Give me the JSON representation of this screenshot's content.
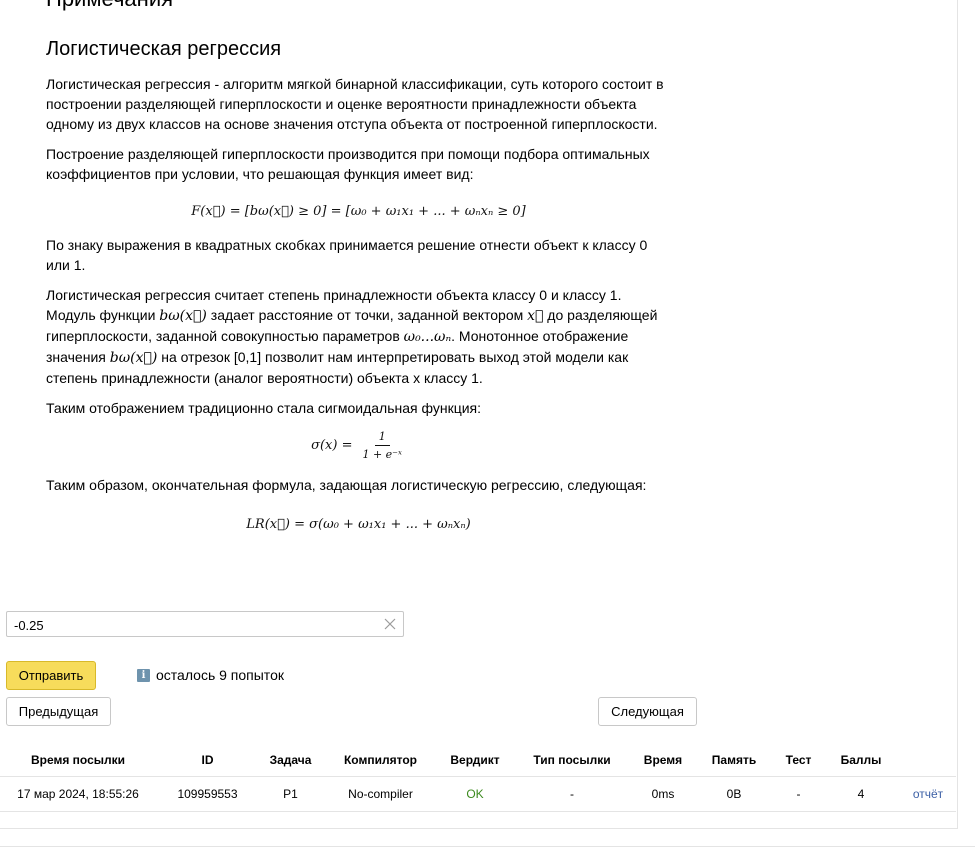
{
  "page": {
    "cut_title": "Примечания"
  },
  "statement": {
    "title": "Логистическая регрессия",
    "p1": "Логистическая регрессия - алгоритм мягкой бинарной классификации, суть которого состоит в построении разделяющей гиперплоскости и оценке вероятности принадлежности объекта одному из двух классов на основе значения отступа объекта от построенной гиперплоскости.",
    "p2": "Построение разделяющей гиперплоскости производится при помощи подбора оптимальных коэффициентов при условии, что решающая функция имеет вид:",
    "formula1": "F(x⃗) = [bω(x⃗) ≥ 0] = [ω₀ + ω₁x₁ + ... + ωₙxₙ ≥ 0]",
    "p3": "По знаку выражения в квадратных скобках принимается решение отнести объект к классу 0 или 1.",
    "p4_a": "Логистическая регрессия считает степень принадлежности объекта классу 0 и классу 1. Модуль функции ",
    "p4_m1": "bω(x⃗)",
    "p4_b": " задает расстояние от точки, заданной вектором ",
    "p4_m2": "x⃗",
    "p4_c": " до разделяющей гиперплоскости, заданной совокупностью параметров ",
    "p4_m3": "ω₀...ωₙ",
    "p4_d": ". Монотонное отображение значения ",
    "p4_m4": "bω(x⃗)",
    "p4_e": " на отрезок [0,1] позволит нам интерпретировать выход этой модели как степень принадлежности (аналог вероятности) объекта x классу 1.",
    "p5": "Таким отображением традиционно стала сигмоидальная функция:",
    "formula2_lhs": "σ(x) =",
    "formula2_num": "1",
    "formula2_den": "1 + e⁻ˣ",
    "p6": "Таким образом, окончательная формула, задающая логистическую регрессию, следующая:",
    "formula3": "LR(x⃗) = σ(ω₀ + ω₁x₁ + ... + ωₙxₙ)"
  },
  "answer": {
    "value": "-0.25",
    "icon": "close-icon"
  },
  "actions": {
    "submit_label": "Отправить",
    "attempts_text": "осталось 9 попыток",
    "info_icon": "i",
    "prev_label": "Предыдущая",
    "next_label": "Следующая"
  },
  "submissions": {
    "headers": [
      "Время посылки",
      "ID",
      "Задача",
      "Компилятор",
      "Вердикт",
      "Тип посылки",
      "Время",
      "Память",
      "Тест",
      "Баллы",
      ""
    ],
    "rows": [
      {
        "time": "17 мар 2024, 18:55:26",
        "id": "109959553",
        "task": "P1",
        "compiler": "No-compiler",
        "verdict": "OK",
        "type": "-",
        "run_time": "0ms",
        "memory": "0B",
        "test": "-",
        "score": "4",
        "report": "отчёт"
      }
    ],
    "colors": {
      "verdict_ok": "#3c8a1e",
      "link": "#3b5fa5",
      "submit_bg": "#f7dc5b"
    }
  }
}
